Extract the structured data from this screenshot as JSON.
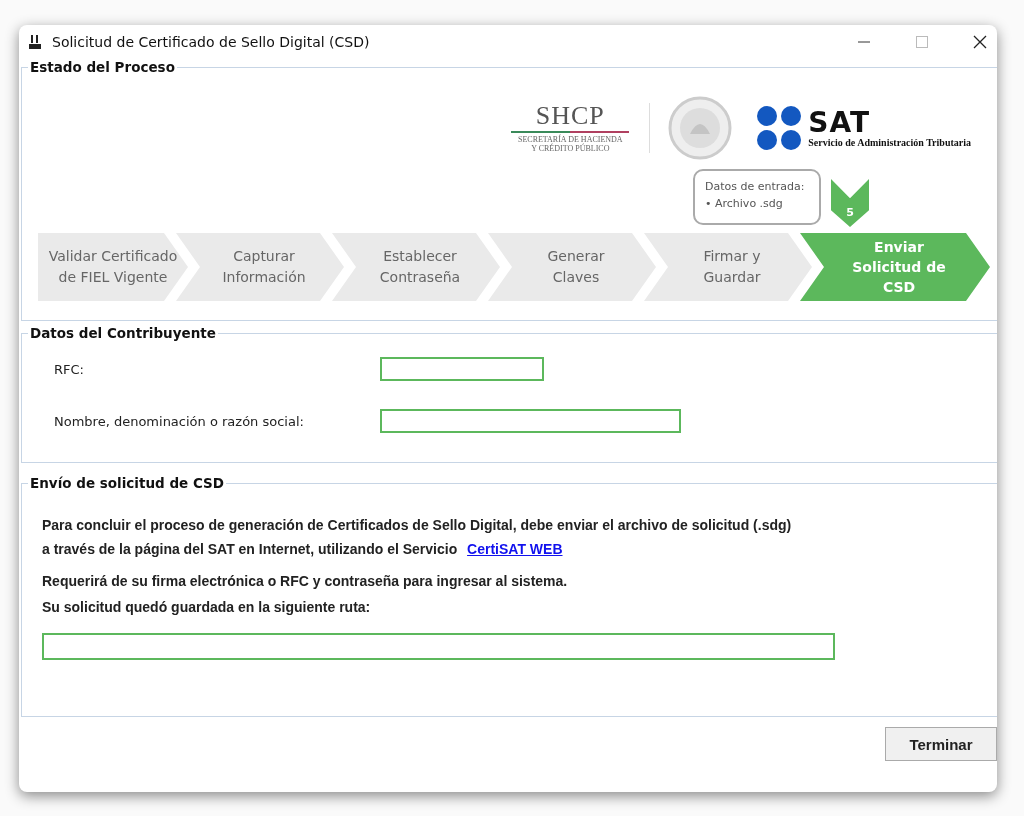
{
  "window": {
    "title": "Solicitud de Certificado de Sello Digital (CSD)"
  },
  "process": {
    "legend": "Estado del Proceso",
    "logos": {
      "shcp": "SHCP",
      "shcp_lines": [
        "SECRETARÍA DE HACIENDA",
        "Y CRÉDITO PÚBLICO"
      ],
      "sat": "SAT",
      "sat_subtitle": "Servicio de Administración Tributaria"
    },
    "callout": {
      "title": "Datos de entrada:",
      "items": [
        "• Archivo .sdg"
      ]
    },
    "marker": "5",
    "steps": [
      {
        "lines": [
          "Validar Certificado",
          "de FIEL Vigente"
        ],
        "selected": false
      },
      {
        "lines": [
          "Capturar",
          "Información"
        ],
        "selected": false
      },
      {
        "lines": [
          "Establecer",
          "Contraseña"
        ],
        "selected": false
      },
      {
        "lines": [
          "Generar",
          "Claves"
        ],
        "selected": false
      },
      {
        "lines": [
          "Firmar y",
          "Guardar"
        ],
        "selected": false
      },
      {
        "lines": [
          "Enviar",
          "Solicitud de",
          "CSD"
        ],
        "selected": true
      }
    ]
  },
  "taxpayer": {
    "legend": "Datos del Contribuyente",
    "fields": [
      {
        "label": "RFC:",
        "kind": "short"
      },
      {
        "label": "Nombre, denominación o razón social:",
        "kind": "long"
      }
    ]
  },
  "submission": {
    "legend": "Envío de solicitud de CSD",
    "text": "Para concluir el proceso de generación de Certificados de Sello Digital, debe enviar el archivo de solicitud (.sdg) a través de la página del SAT en Internet, utilizando el Servicio",
    "link": "CertiSAT WEB",
    "notes": [
      "Requerirá de su firma electrónica o RFC y contraseña para ingresar al sistema.",
      "Su solicitud quedó guardada en la siguiente ruta:"
    ]
  },
  "buttons": [
    "Terminar"
  ]
}
